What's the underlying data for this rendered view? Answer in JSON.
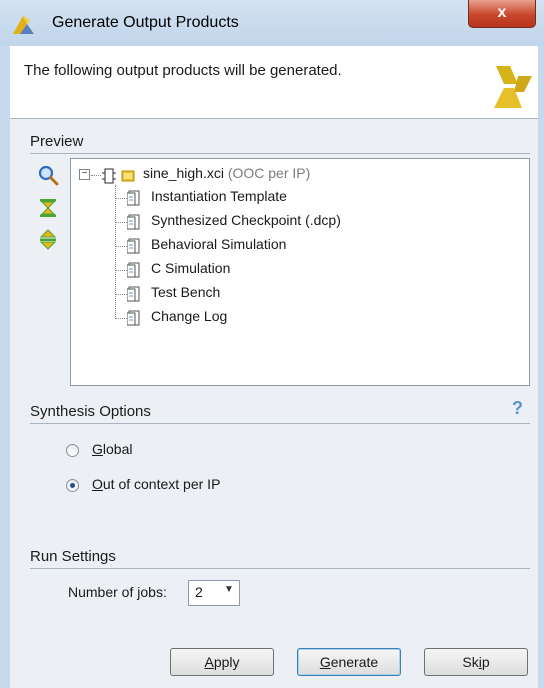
{
  "window": {
    "title": "Generate Output Products",
    "close_label": "x"
  },
  "header": {
    "message": "The following output products will be generated."
  },
  "preview": {
    "section_title": "Preview",
    "tree": {
      "root_name": "sine_high.xci",
      "root_hint": "(OOC per IP)",
      "children": [
        "Instantiation Template",
        "Synthesized Checkpoint (.dcp)",
        "Behavioral Simulation",
        "C Simulation",
        "Test Bench",
        "Change Log"
      ]
    },
    "tools": [
      "search-icon",
      "collapse-all-icon",
      "expand-all-icon"
    ]
  },
  "synthesis": {
    "section_title": "Synthesis Options",
    "help": "?",
    "options": [
      {
        "label_key": "G",
        "label_rest": "lobal",
        "selected": false
      },
      {
        "label_key": "O",
        "label_rest": "ut of context per IP",
        "selected": true
      }
    ]
  },
  "run_settings": {
    "section_title": "Run Settings",
    "jobs_label_pre": "Number of ",
    "jobs_label_key": "j",
    "jobs_label_post": "obs:",
    "jobs_value": "2"
  },
  "buttons": {
    "apply_key": "A",
    "apply_rest": "pply",
    "generate_key": "G",
    "generate_rest": "enerate",
    "skip_pre": "Sk",
    "skip_key": "i",
    "skip_post": "p"
  },
  "colors": {
    "accent": "#5a8fd0",
    "logo": "#d7b31b",
    "close": "#c9462b"
  }
}
